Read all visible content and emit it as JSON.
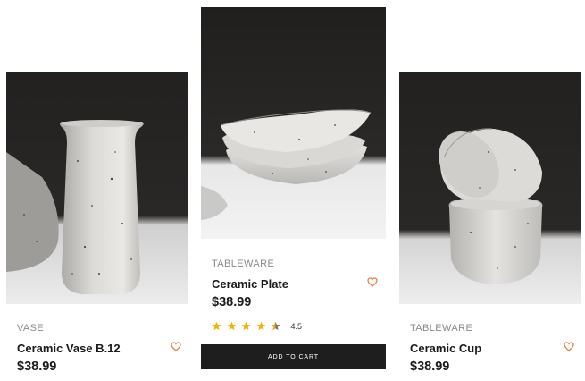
{
  "products": [
    {
      "category": "VASE",
      "name": "Ceramic Vase B.12",
      "price": "$38.99",
      "image": "white speckled ceramic vase"
    },
    {
      "category": "TABLEWARE",
      "name": "Ceramic Plate",
      "price": "$38.99",
      "image": "stacked white speckled ceramic bowls",
      "rating": 4.5,
      "rating_label": "4.5",
      "add_to_cart_label": "ADD TO CART"
    },
    {
      "category": "TABLEWARE",
      "name": "Ceramic Cup",
      "price": "$38.99",
      "image": "stacked white speckled ceramic cups"
    }
  ],
  "colors": {
    "accent_heart": "#e6783a",
    "star": "#f5b301",
    "button_bg": "#1e1e1f"
  },
  "icons": [
    "heart-outline-icon",
    "star-icon"
  ]
}
